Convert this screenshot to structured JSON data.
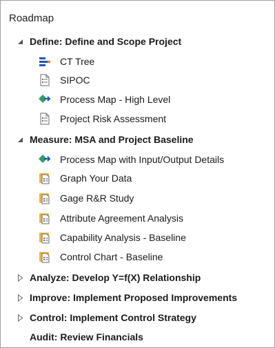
{
  "panel": {
    "title": "Roadmap"
  },
  "sections": [
    {
      "label": "Define: Define and Scope Project",
      "expanded": true,
      "items": [
        {
          "label": "CT Tree",
          "icon": "ct-tree-icon"
        },
        {
          "label": "SIPOC",
          "icon": "form-icon"
        },
        {
          "label": "Process Map - High Level",
          "icon": "process-map-icon"
        },
        {
          "label": "Project Risk Assessment",
          "icon": "form-icon"
        }
      ]
    },
    {
      "label": "Measure: MSA and Project Baseline",
      "expanded": true,
      "items": [
        {
          "label": "Process Map with Input/Output Details",
          "icon": "process-map-icon"
        },
        {
          "label": "Graph Your Data",
          "icon": "analysis-capture-icon"
        },
        {
          "label": "Gage R&R Study",
          "icon": "analysis-capture-icon"
        },
        {
          "label": "Attribute Agreement Analysis",
          "icon": "analysis-capture-icon"
        },
        {
          "label": "Capability Analysis - Baseline",
          "icon": "analysis-capture-icon"
        },
        {
          "label": "Control Chart - Baseline",
          "icon": "analysis-capture-icon"
        }
      ]
    },
    {
      "label": "Analyze: Develop Y=f(X) Relationship",
      "expanded": false,
      "items": []
    },
    {
      "label": "Improve: Implement Proposed Improvements",
      "expanded": false,
      "items": []
    },
    {
      "label": "Control: Implement Control Strategy",
      "expanded": false,
      "items": []
    },
    {
      "label": "Audit: Review Financials",
      "expanded": false,
      "leaf": true,
      "items": []
    }
  ]
}
